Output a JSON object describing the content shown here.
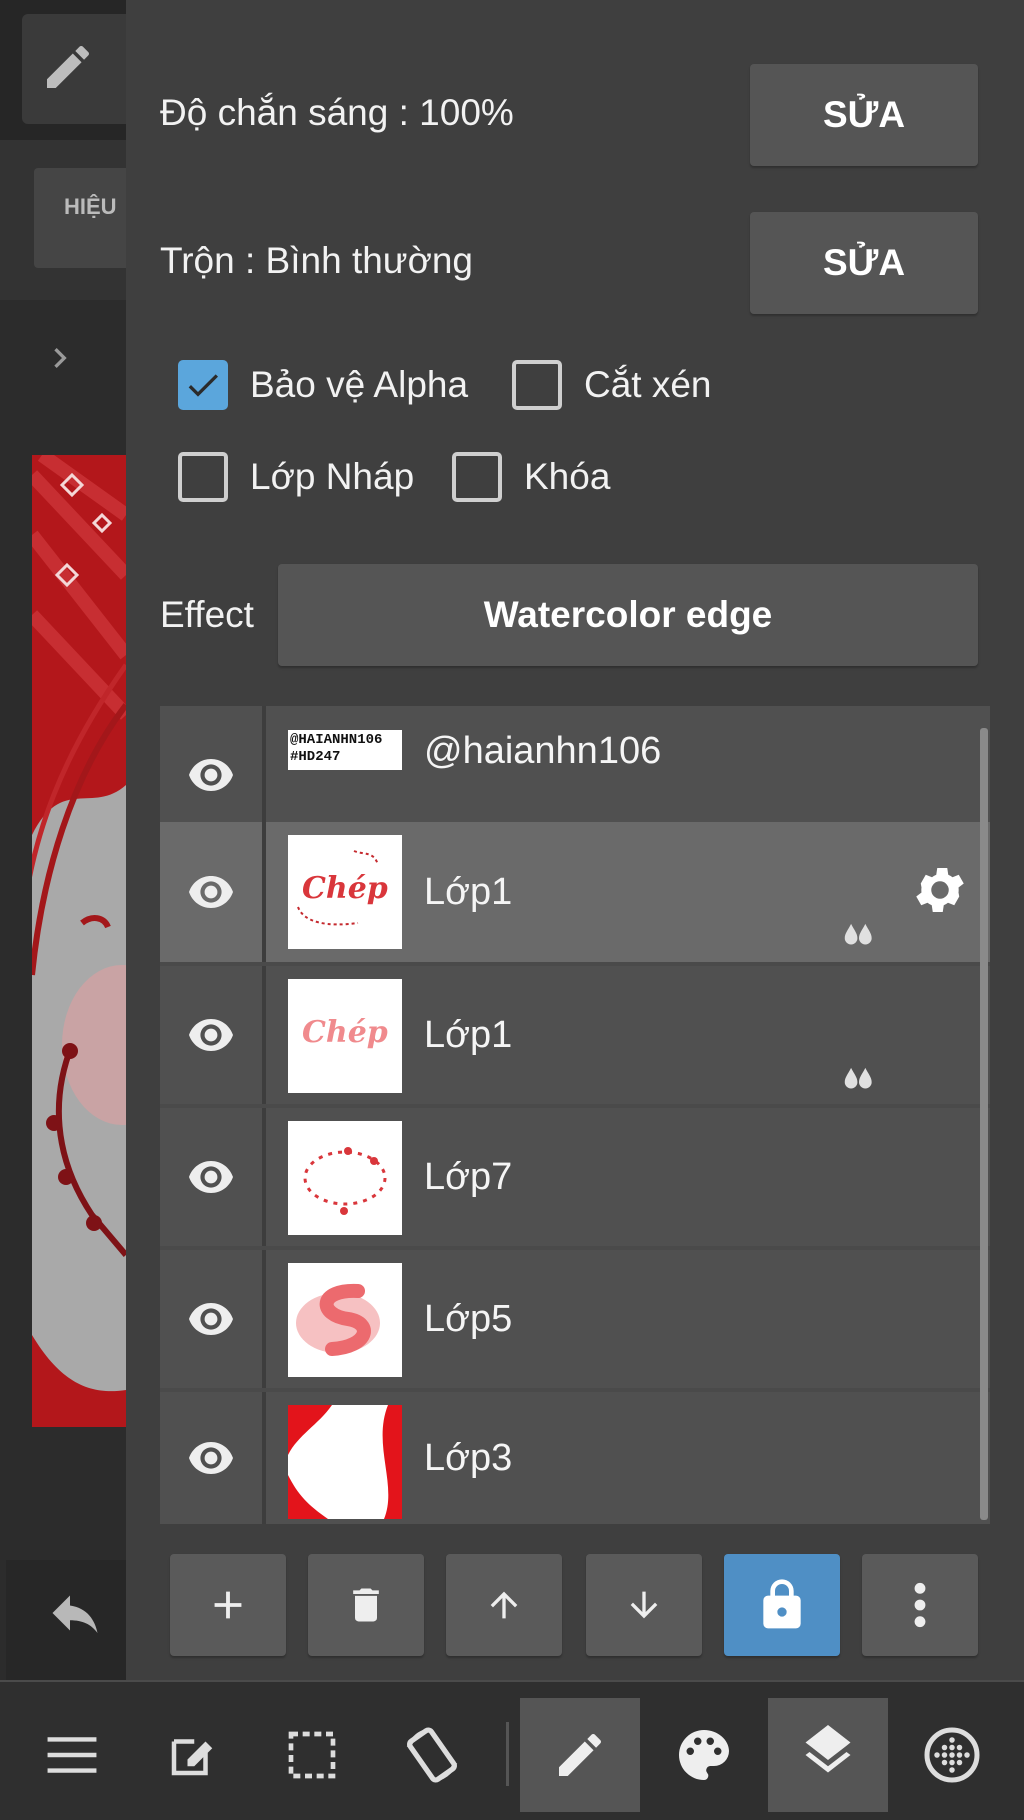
{
  "side": {
    "tab_label": "HIỆU",
    "pen_icon": "pencil-icon",
    "expand_icon": "chevron-right-icon",
    "undo_icon": "undo-icon"
  },
  "settings": {
    "opacity_label": "Độ chắn sáng : 100%",
    "opacity_button": "SỬA",
    "blend_label": "Trộn : Bình thường",
    "blend_button": "SỬA",
    "checkboxes": {
      "alpha": {
        "label": "Bảo vệ Alpha",
        "checked": true
      },
      "clip": {
        "label": "Cắt xén",
        "checked": false
      },
      "draft": {
        "label": "Lớp Nháp",
        "checked": false
      },
      "lock": {
        "label": "Khóa",
        "checked": false
      }
    },
    "effect_label": "Effect",
    "effect_value": "Watercolor edge"
  },
  "layers": [
    {
      "name": "@haianhn106",
      "thumb_text_1": "@HAIANHN106",
      "thumb_text_2": "#HD247",
      "selected": false
    },
    {
      "name": "Lớp1",
      "thumb_text": "Chép",
      "selected": true,
      "watercolor": true,
      "gear": true
    },
    {
      "name": "Lớp1",
      "thumb_text": "Chép",
      "selected": false,
      "watercolor": true
    },
    {
      "name": "Lớp7",
      "selected": false
    },
    {
      "name": "Lớp5",
      "selected": false
    },
    {
      "name": "Lớp3",
      "selected": false
    }
  ],
  "actions": [
    "add-icon",
    "trash-icon",
    "arrow-up-icon",
    "arrow-down-icon",
    "lock-icon",
    "more-vertical-icon"
  ],
  "colors": {
    "accent": "#4f8fc5",
    "check": "#5ba6dc",
    "panel": "#3f3f3f"
  },
  "toolbar": [
    "menu-icon",
    "edit-icon",
    "selection-icon",
    "rotate-icon",
    "pen-icon",
    "palette-icon",
    "layers-icon",
    "grid-icon"
  ]
}
